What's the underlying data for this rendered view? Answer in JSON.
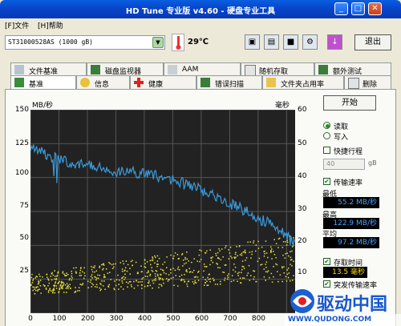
{
  "window": {
    "title": "HD Tune 专业版 v4.60 - 硬盘专业工具"
  },
  "menu": {
    "file": "[F]文件",
    "help": "[H]帮助"
  },
  "toolbar": {
    "drive": "ST31000528AS (1000 gB)",
    "temperature": "29℃",
    "exit": "退出"
  },
  "tabs_top": [
    "文件基准",
    "磁盘监视器",
    "AAM",
    "随机存取",
    "额外测试"
  ],
  "tabs_bottom": [
    "基准",
    "信息",
    "健康",
    "错误扫描",
    "文件夹占用率",
    "删除"
  ],
  "graph": {
    "left_unit": "MB/秒",
    "right_unit": "毫秒",
    "left_ticks": [
      "150",
      "125",
      "100",
      "75",
      "50",
      "25"
    ],
    "right_ticks": [
      "60",
      "50",
      "40",
      "30",
      "20",
      "10"
    ],
    "x_ticks": [
      "0",
      "100",
      "200",
      "300",
      "400",
      "500",
      "600",
      "700",
      "800"
    ]
  },
  "chart_data": {
    "type": "line",
    "series": [
      {
        "name": "传输速率",
        "x": [
          0,
          50,
          100,
          150,
          200,
          250,
          300,
          350,
          400,
          450,
          500,
          550,
          600,
          650,
          700,
          750,
          800,
          850,
          900,
          930
        ],
        "values": [
          122,
          118,
          113,
          111,
          109,
          107,
          105,
          104,
          103,
          101,
          98,
          95,
          91,
          86,
          81,
          76,
          70,
          65,
          57,
          50
        ]
      },
      {
        "name": "存取时间",
        "type": "scatter",
        "x_range": [
          0,
          930
        ],
        "ms_range": [
          3,
          22
        ]
      }
    ],
    "ylim_left": [
      0,
      150
    ],
    "ylim_right": [
      0,
      60
    ],
    "xlim": [
      0,
      930
    ]
  },
  "panel": {
    "start": "开始",
    "read": "读取",
    "write": "写入",
    "quick": "快捷行程",
    "quick_value": "40",
    "quick_unit": "gB",
    "transfer": "传输速率",
    "min_label": "最低",
    "min_value": "55.2 MB/秒",
    "max_label": "最高",
    "max_value": "122.9 MB/秒",
    "avg_label": "平均",
    "avg_value": "97.2 MB/秒",
    "access": "存取时间",
    "access_value": "13.5 毫秒",
    "burst": "突发传输速率"
  },
  "watermark": {
    "site": "WWW.QUDONG.COM",
    "brand": "驱动中国"
  }
}
